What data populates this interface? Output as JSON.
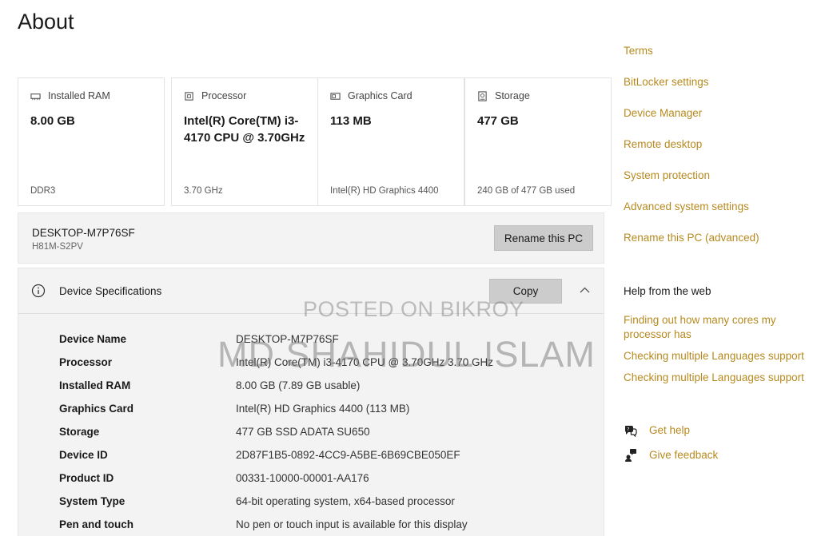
{
  "page": {
    "title": "About"
  },
  "cards": [
    {
      "icon": "ram-icon",
      "label": "Installed RAM",
      "value": "8.00 GB",
      "sub": "DDR3"
    },
    {
      "icon": "processor-icon",
      "label": "Processor",
      "value": "Intel(R) Core(TM) i3-4170 CPU @ 3.70GHz",
      "sub": "3.70 GHz"
    },
    {
      "icon": "graphics-card-icon",
      "label": "Graphics Card",
      "value": "113 MB",
      "sub": "Intel(R) HD Graphics 4400"
    },
    {
      "icon": "storage-icon",
      "label": "Storage",
      "value": "477 GB",
      "sub": "240 GB of 477 GB used"
    }
  ],
  "pc": {
    "name": "DESKTOP-M7P76SF",
    "model": "H81M-S2PV",
    "rename_label": "Rename this PC"
  },
  "specs": {
    "title": "Device Specifications",
    "copy_label": "Copy",
    "rows": [
      {
        "key": "Device Name",
        "value": "DESKTOP-M7P76SF"
      },
      {
        "key": "Processor",
        "value": "Intel(R) Core(TM) i3-4170 CPU @ 3.70GHz   3.70 GHz"
      },
      {
        "key": "Installed RAM",
        "value": "8.00 GB (7.89 GB usable)"
      },
      {
        "key": "Graphics Card",
        "value": "Intel(R) HD Graphics 4400 (113 MB)"
      },
      {
        "key": "Storage",
        "value": "477 GB SSD ADATA SU650"
      },
      {
        "key": "Device ID",
        "value": "2D87F1B5-0892-4CC9-A5BE-6B69CBE050EF"
      },
      {
        "key": "Product ID",
        "value": "00331-10000-00001-AA176"
      },
      {
        "key": "System Type",
        "value": "64-bit operating system, x64-based processor"
      },
      {
        "key": "Pen and touch",
        "value": "No pen or touch input is available for this display"
      }
    ]
  },
  "related_links": [
    "Terms",
    "BitLocker settings",
    "Device Manager",
    "Remote desktop",
    "System protection",
    "Advanced system settings",
    "Rename this PC (advanced)"
  ],
  "help": {
    "heading": "Help from the web",
    "links": [
      "Finding out how many cores my processor has",
      "Checking multiple Languages support",
      "Checking multiple Languages support"
    ],
    "get_help": "Get help",
    "give_feedback": "Give feedback"
  },
  "watermark": {
    "line1": "POSTED ON BIKROY",
    "line2": "MD SHAHIDUL ISLAM"
  },
  "colors": {
    "link": "#b78a1f",
    "panel": "#f3f3f3",
    "button": "#cccccc"
  }
}
